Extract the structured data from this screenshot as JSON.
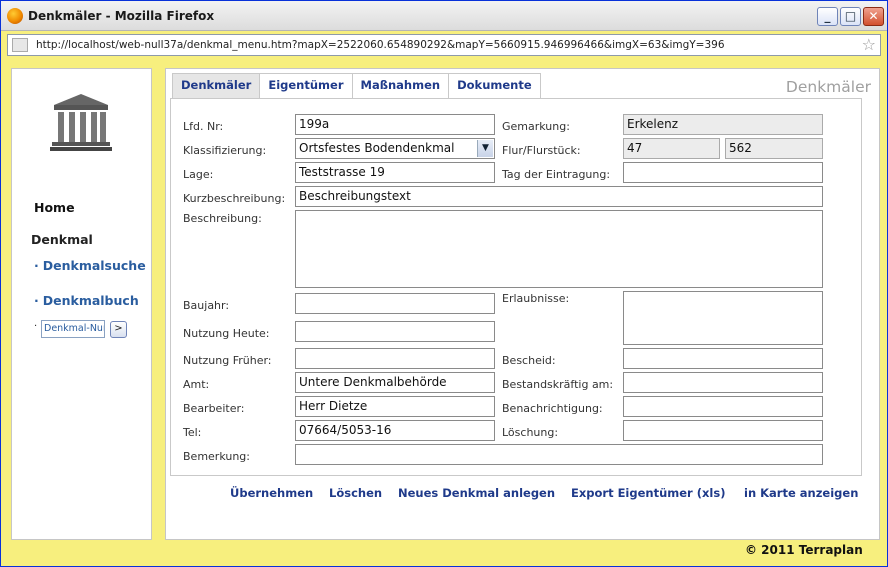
{
  "window": {
    "title": "Denkmäler - Mozilla Firefox",
    "url": "http://localhost/web-null37a/denkmal_menu.htm?mapX=2522060.654890292&mapY=5660915.946996466&imgX=63&imgY=396"
  },
  "sidebar": {
    "home": "Home",
    "denkmal": "Denkmal",
    "denkmalsuche": "Denkmalsuche",
    "denkmalbuch": "Denkmalbuch",
    "mini_input_value": "Denkmal-Nur",
    "mini_button": ">"
  },
  "tabs": [
    "Denkmäler",
    "Eigentümer",
    "Maßnahmen",
    "Dokumente"
  ],
  "main_title": "Denkmäler",
  "form": {
    "lfd_label": "Lfd. Nr:",
    "lfd_value": "199a",
    "gemarkung_label": "Gemarkung:",
    "gemarkung_value": "Erkelenz",
    "klass_label": "Klassifizierung:",
    "klass_value": "Ortsfestes Bodendenkmal",
    "flur_label": "Flur/Flurstück:",
    "flur_value": "47",
    "flurstueck_value": "562",
    "lage_label": "Lage:",
    "lage_value": "Teststrasse 19",
    "tag_label": "Tag der Eintragung:",
    "tag_value": "",
    "kurz_label": "Kurzbeschreibung:",
    "kurz_value": "Beschreibungstext",
    "beschr_label": "Beschreibung:",
    "beschr_value": "",
    "baujahr_label": "Baujahr:",
    "baujahr_value": "",
    "erlaub_label": "Erlaubnisse:",
    "erlaub_value": "",
    "nutz_heute_label": "Nutzung Heute:",
    "nutz_heute_value": "",
    "nutz_frueher_label": "Nutzung Früher:",
    "nutz_frueher_value": "",
    "bescheid_label": "Bescheid:",
    "bescheid_value": "",
    "amt_label": "Amt:",
    "amt_value": "Untere Denkmalbehörde",
    "bestand_label": "Bestandskräftig am:",
    "bestand_value": "",
    "bearb_label": "Bearbeiter:",
    "bearb_value": "Herr Dietze",
    "benach_label": "Benachrichtigung:",
    "benach_value": "",
    "tel_label": "Tel:",
    "tel_value": "07664/5053-16",
    "loesch_label": "Löschung:",
    "loesch_value": "",
    "bemerk_label": "Bemerkung:",
    "bemerk_value": ""
  },
  "actions": {
    "uebernehmen": "Übernehmen",
    "loeschen": "Löschen",
    "neu": "Neues Denkmal anlegen",
    "export": "Export Eigentümer (xls)",
    "karte": "in Karte anzeigen"
  },
  "footer": "© 2011 Terraplan"
}
